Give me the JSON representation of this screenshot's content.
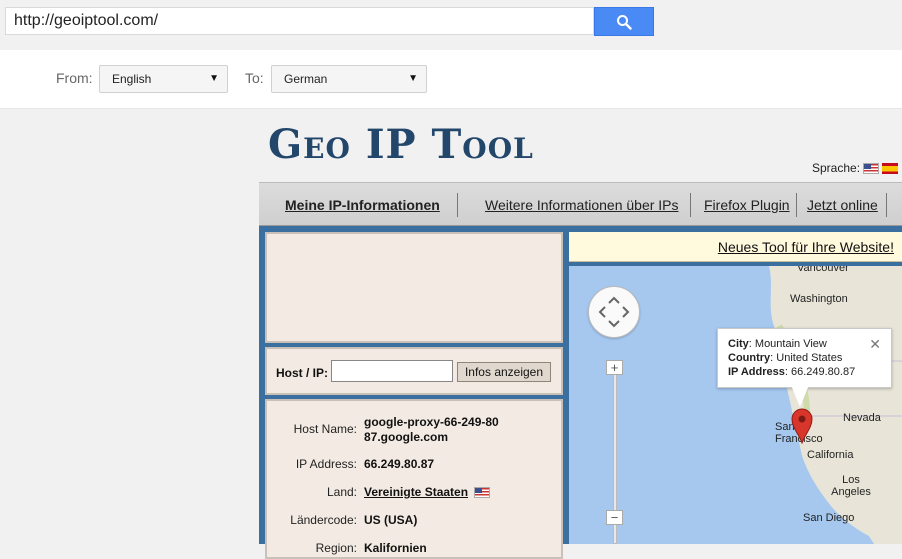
{
  "browser": {
    "url": "http://geoiptool.com/"
  },
  "translate": {
    "from_label": "From:",
    "from_value": "English",
    "to_label": "To:",
    "to_value": "German"
  },
  "site": {
    "logo": "Geo IP Tool",
    "language_label": "Sprache:"
  },
  "nav": {
    "items": [
      "Meine IP-Informationen",
      "Weitere Informationen über IPs",
      "Firefox Plugin",
      "Jetzt online"
    ]
  },
  "host_form": {
    "label": "Host / IP:",
    "input_value": "",
    "button": "Infos anzeigen"
  },
  "info": {
    "rows": [
      {
        "key": "Host Name:",
        "value": "google-proxy-66-249-80 87.google.com"
      },
      {
        "key": "IP Address:",
        "value": "66.249.80.87"
      },
      {
        "key": "Land:",
        "value": "Vereinigte Staaten"
      },
      {
        "key": "Ländercode:",
        "value": "US (USA)"
      },
      {
        "key": "Region:",
        "value": "Kalifornien"
      }
    ]
  },
  "banner": {
    "link": "Neues Tool für Ihre Website!"
  },
  "map": {
    "places": [
      "Vancouver",
      "Washington",
      "Nevada",
      "San Francisco",
      "California",
      "Los Angeles",
      "San Diego"
    ],
    "popup": {
      "city_label": "City",
      "city": "Mountain View",
      "country_label": "Country",
      "country": "United States",
      "ip_label": "IP Address",
      "ip": "66.249.80.87"
    }
  },
  "colors": {
    "search_button": "#4a8af4",
    "logo": "#23466b",
    "main_frame": "#3b6fa0",
    "panel_bg": "#f3ebe3",
    "banner_bg": "#fff9dd",
    "water": "#a6c8ef",
    "land": "#e8e5d8",
    "marker": "#d9362b"
  },
  "icons": {
    "search": "search-icon",
    "us_flag": "us-flag-icon",
    "es_flag": "spain-flag-icon",
    "pan": "pan-control-icon",
    "marker": "map-marker-icon",
    "close": "close-icon"
  }
}
